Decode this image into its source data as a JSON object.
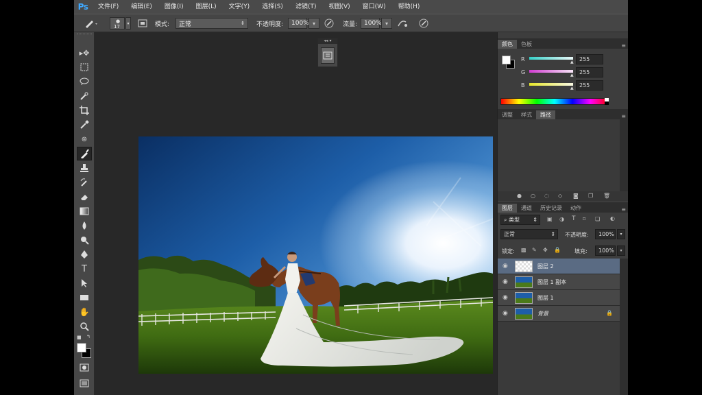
{
  "app": {
    "logo": "Ps"
  },
  "menu": [
    "文件(F)",
    "编辑(E)",
    "图像(I)",
    "图层(L)",
    "文字(Y)",
    "选择(S)",
    "滤镜(T)",
    "视图(V)",
    "窗口(W)",
    "帮助(H)"
  ],
  "options": {
    "brush_size": "17",
    "mode_label": "模式:",
    "mode_value": "正常",
    "opacity_label": "不透明度:",
    "opacity_value": "100%",
    "flow_label": "流量:",
    "flow_value": "100%"
  },
  "color_panel": {
    "tabs": [
      "颜色",
      "色板"
    ],
    "channels": [
      {
        "label": "R",
        "value": "255"
      },
      {
        "label": "G",
        "value": "255"
      },
      {
        "label": "B",
        "value": "255"
      }
    ]
  },
  "adjust_panel": {
    "tabs": [
      "调整",
      "样式",
      "路径"
    ]
  },
  "layers_panel": {
    "tabs": [
      "图层",
      "通道",
      "历史记录",
      "动作"
    ],
    "filter_label": "类型",
    "blend_mode": "正常",
    "opacity_label": "不透明度:",
    "opacity_value": "100%",
    "lock_label": "锁定:",
    "fill_label": "填充:",
    "fill_value": "100%",
    "layers": [
      {
        "name": "图层 2",
        "selected": true
      },
      {
        "name": "图层 1 副本",
        "selected": false
      },
      {
        "name": "图层 1",
        "selected": false
      },
      {
        "name": "背景",
        "selected": false
      }
    ]
  },
  "colors": {
    "app_bg": "#282828",
    "panel_bg": "#3d3d3d",
    "selection": "#5a6b83",
    "r_slider": "#35d0c8",
    "g_slider": "#d23cd2",
    "b_slider": "#e6e62a"
  }
}
